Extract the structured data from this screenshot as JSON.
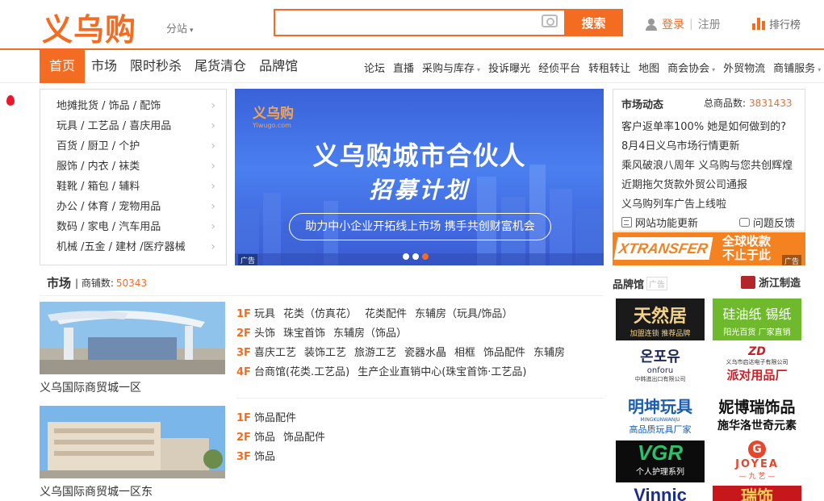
{
  "header": {
    "logo": "义乌购",
    "substation": "分站",
    "search_placeholder": "",
    "search_button": "搜索",
    "login": "登录",
    "divider": "|",
    "register": "注册",
    "ranking": "排行榜"
  },
  "nav": {
    "main": [
      "首页",
      "市场",
      "限时秒杀",
      "尾货清仓",
      "品牌馆"
    ],
    "sub": [
      {
        "label": "论坛",
        "dropdown": false
      },
      {
        "label": "直播",
        "dropdown": false
      },
      {
        "label": "采购与库存",
        "dropdown": true
      },
      {
        "label": "投诉曝光",
        "dropdown": false
      },
      {
        "label": "经侦平台",
        "dropdown": false
      },
      {
        "label": "转租转让",
        "dropdown": false
      },
      {
        "label": "地图",
        "dropdown": false
      },
      {
        "label": "商会协会",
        "dropdown": true
      },
      {
        "label": "外贸物流",
        "dropdown": false
      },
      {
        "label": "商铺服务",
        "dropdown": true
      }
    ],
    "dropdown_caret": "▾"
  },
  "categories": [
    "地摊批货 / 饰品 / 配饰",
    "玩具 / 工艺品 / 喜庆用品",
    "百货 / 厨卫 / 个护",
    "服饰 / 内衣 / 袜类",
    "鞋靴 / 箱包 / 辅料",
    "办公 / 体育 / 宠物用品",
    "数码 / 家电 / 汽车用品",
    "机械 /五金 / 建材 /医疗器械"
  ],
  "category_arrow": "›",
  "banner": {
    "logo": "义乌购",
    "logo_sub": "Yiwugo.com",
    "title": "义乌购城市合伙人",
    "subtitle": "招募计划",
    "pill": "助力中小企业开拓线上市场  携手共创财富机会",
    "ad": "广告"
  },
  "news": {
    "title": "市场动态",
    "total_label": "总商品数:",
    "total": "3831433",
    "items": [
      "客户返单率100% 她是如何做到的?",
      "8月4日义乌市场行情更新",
      "乘风破浪八周年 义乌购与您共创辉煌",
      "近期拖欠货款外贸公司通报",
      "义乌购列车广告上线啦"
    ],
    "tool_update": "网站功能更新",
    "tool_feedback": "问题反馈"
  },
  "xtransfer": {
    "logo": "XTRANSFER",
    "line1": "全球收款",
    "line2": "不止于此",
    "ad": "广告"
  },
  "market": {
    "title": "市场",
    "count_label": "| 商铺数:",
    "count": "50343",
    "malls": [
      {
        "name": "义乌国际商贸城一区",
        "floors": [
          {
            "floor": "1F",
            "items": [
              "玩具",
              "花类（仿真花）",
              "花类配件",
              "东辅房（玩具/饰品）"
            ]
          },
          {
            "floor": "2F",
            "items": [
              "头饰",
              "珠宝首饰",
              "东辅房（饰品）"
            ]
          },
          {
            "floor": "3F",
            "items": [
              "喜庆工艺",
              "装饰工艺",
              "旅游工艺",
              "瓷器水晶",
              "相框",
              "饰品配件",
              "东辅房"
            ]
          },
          {
            "floor": "4F",
            "items": [
              "台商馆(花类.工艺品)",
              "生产企业直销中心(珠宝首饰·工艺品)"
            ]
          }
        ]
      },
      {
        "name": "义乌国际商贸城一区东",
        "floors": [
          {
            "floor": "1F",
            "items": [
              "饰品配件"
            ]
          },
          {
            "floor": "2F",
            "items": [
              "饰品",
              "饰品配件"
            ]
          },
          {
            "floor": "3F",
            "items": [
              "饰品"
            ]
          }
        ]
      }
    ]
  },
  "brand": {
    "title": "品牌馆",
    "ad": "广告",
    "zhejiang": "浙江制造",
    "cells": [
      {
        "line1": "天然居",
        "line2": "加盟连锁 推荐品牌"
      },
      {
        "line1": "硅油纸  锡纸",
        "line2": "阳光百货 厂家直销"
      },
      {
        "line1": "온포유",
        "line2": "onforu",
        "line3": "中韩進出口有限公司"
      },
      {
        "line1": "ZD",
        "line2": "义乌市启达电子有限公司",
        "line3": "派对用品厂"
      },
      {
        "line1": "明坤玩具",
        "line2": "MINGKUNWANJU",
        "line3": "高品质玩具厂家"
      },
      {
        "line1": "妮博瑞饰品",
        "line2": "施华洛世奇元素"
      },
      {
        "line1": "VGR",
        "line2": "个人护理系列"
      },
      {
        "line1": "G",
        "line2": "JOYEA",
        "line3": "— 九 艺 —"
      },
      {
        "line1": "Vinnic"
      },
      {
        "line1": "瑞饰"
      }
    ]
  },
  "colors": {
    "accent": "#f36c21",
    "banner_blue": "#3a62d8"
  }
}
